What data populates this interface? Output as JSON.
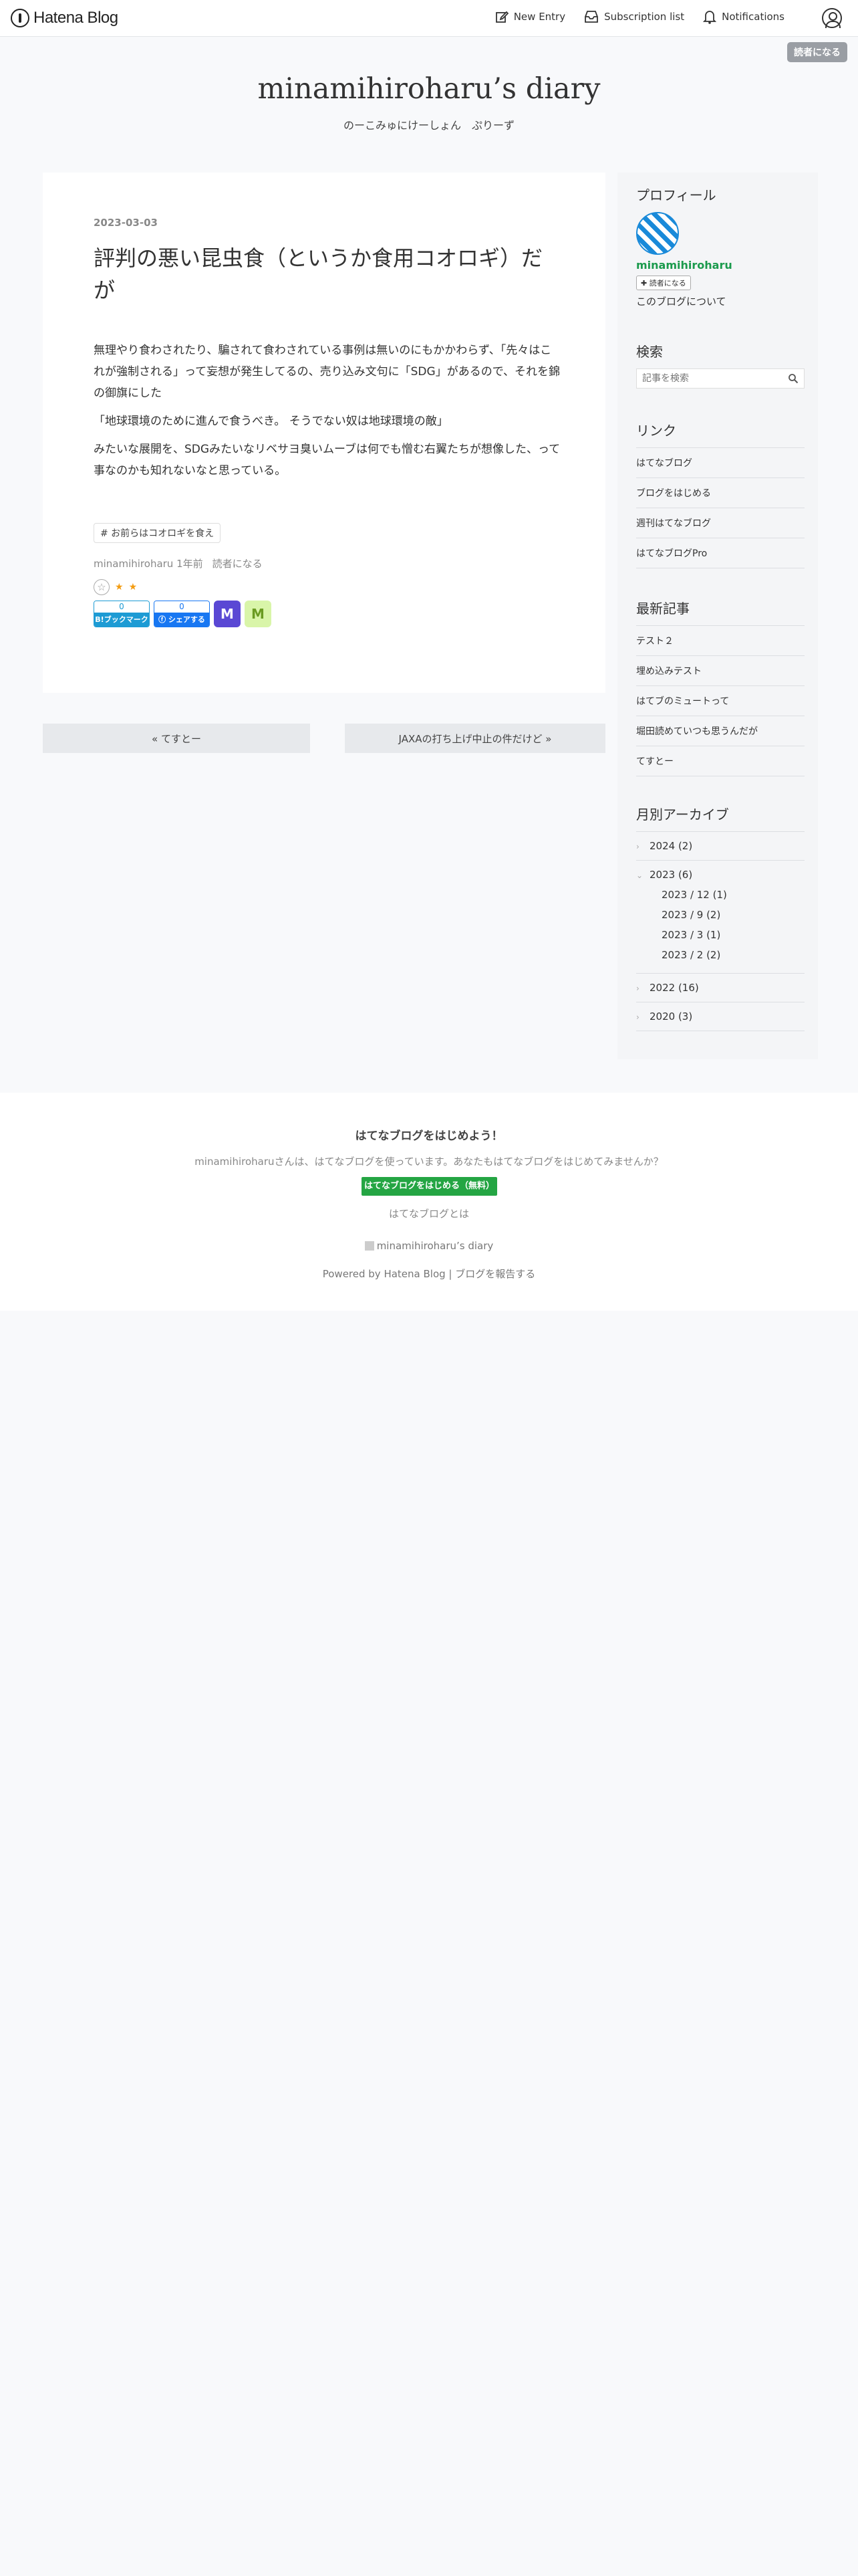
{
  "global_header": {
    "logo_text": "Hatena Blog",
    "new_entry": "New Entry",
    "subscription_list": "Subscription list",
    "notifications": "Notifications",
    "reader_button": "読者になる"
  },
  "blog": {
    "title": "minamihiroharu’s diary",
    "description": "のーこみゅにけーしょん　ぷりーず"
  },
  "entry": {
    "date": "2023-03-03",
    "title": "評判の悪い昆虫食（というか食用コオロギ）だが",
    "paragraphs": [
      "無理やり食わされたり、騙されて食わされている事例は無いのにもかかわらず、「先々はこれが強制される」って妄想が発生してるの、売り込み文句に「SDG」があるので、それを錦の御旗にした",
      "「地球環境のために進んで食うべき。 そうでない奴は地球環境の敵」",
      "みたいな展開を、SDGみたいなリベサヨ臭いムーブは何でも憎む右翼たちが想像した、って事なのかも知れないなと思っている。"
    ],
    "tag": "# お前らはコオロギを食え",
    "author": "minamihiroharu",
    "relative_time": "1年前",
    "subscribe": "読者になる",
    "star_add": "☆",
    "stars": [
      "★",
      "★"
    ],
    "hatena_bookmark": {
      "count": "0",
      "label": "B!ブックマーク"
    },
    "facebook_share": {
      "count": "0",
      "label": "ⓕ シェアする"
    },
    "mastodon": "M",
    "misskey": "M"
  },
  "pager": {
    "prev": "« てすとー",
    "next": "JAXAの打ち上げ中止の件だけど »"
  },
  "sidebar": {
    "profile": {
      "title": "プロフィール",
      "name": "minamihiroharu",
      "follow": "✚ 読者になる",
      "about": "このブログについて"
    },
    "search": {
      "title": "検索",
      "placeholder": "記事を検索"
    },
    "links": {
      "title": "リンク",
      "items": [
        "はてなブログ",
        "ブログをはじめる",
        "週刊はてなブログ",
        "はてなブログPro"
      ]
    },
    "recent": {
      "title": "最新記事",
      "items": [
        "テスト２",
        "埋め込みテスト",
        "はてブのミュートって",
        "堀田読めていつも思うんだが",
        "てすとー"
      ]
    },
    "archive": {
      "title": "月別アーカイブ",
      "years": [
        {
          "label": "2024 (2)",
          "chevron": "›"
        },
        {
          "label": "2023 (6)",
          "chevron": "⌄",
          "months": [
            "2023 / 12 (1)",
            "2023 / 9 (2)",
            "2023 / 3 (1)",
            "2023 / 2 (2)"
          ]
        },
        {
          "label": "2022 (16)",
          "chevron": "›"
        },
        {
          "label": "2020 (3)",
          "chevron": "›"
        }
      ]
    }
  },
  "footer": {
    "title": "はてなブログをはじめよう！",
    "text": "minamihiroharuさんは、はてなブログを使っています。あなたもはてなブログをはじめてみませんか？",
    "button": "はてなブログをはじめる（無料）",
    "about": "はてなブログとは",
    "blog_link": "minamihiroharu’s diary",
    "powered": "Powered by Hatena Blog | ブログを報告する"
  }
}
